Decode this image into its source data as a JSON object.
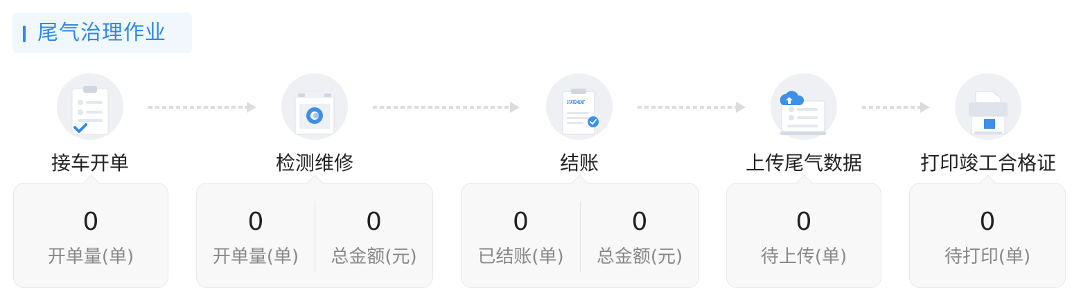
{
  "section": {
    "title": "尾气治理作业"
  },
  "steps": [
    {
      "label": "接车开单",
      "icon": "clipboard-check-icon",
      "stats": [
        {
          "value": "0",
          "label": "开单量(单)"
        }
      ]
    },
    {
      "label": "检测维修",
      "icon": "inspection-machine-icon",
      "stats": [
        {
          "value": "0",
          "label": "开单量(单)"
        },
        {
          "value": "0",
          "label": "总金额(元)"
        }
      ]
    },
    {
      "label": "结账",
      "icon": "statement-icon",
      "statement_text": "STATEMENT",
      "stats": [
        {
          "value": "0",
          "label": "已结账(单)"
        },
        {
          "value": "0",
          "label": "总金额(元)"
        }
      ]
    },
    {
      "label": "上传尾气数据",
      "icon": "cloud-upload-icon",
      "stats": [
        {
          "value": "0",
          "label": "待上传(单)"
        }
      ]
    },
    {
      "label": "打印竣工合格证",
      "icon": "printer-icon",
      "stats": [
        {
          "value": "0",
          "label": "待打印(单)"
        }
      ]
    }
  ],
  "colors": {
    "accent": "#2f88e8",
    "title_bg": "#f0f8fe",
    "card_bg": "#f8f8f8",
    "arrow": "#dddddd"
  }
}
